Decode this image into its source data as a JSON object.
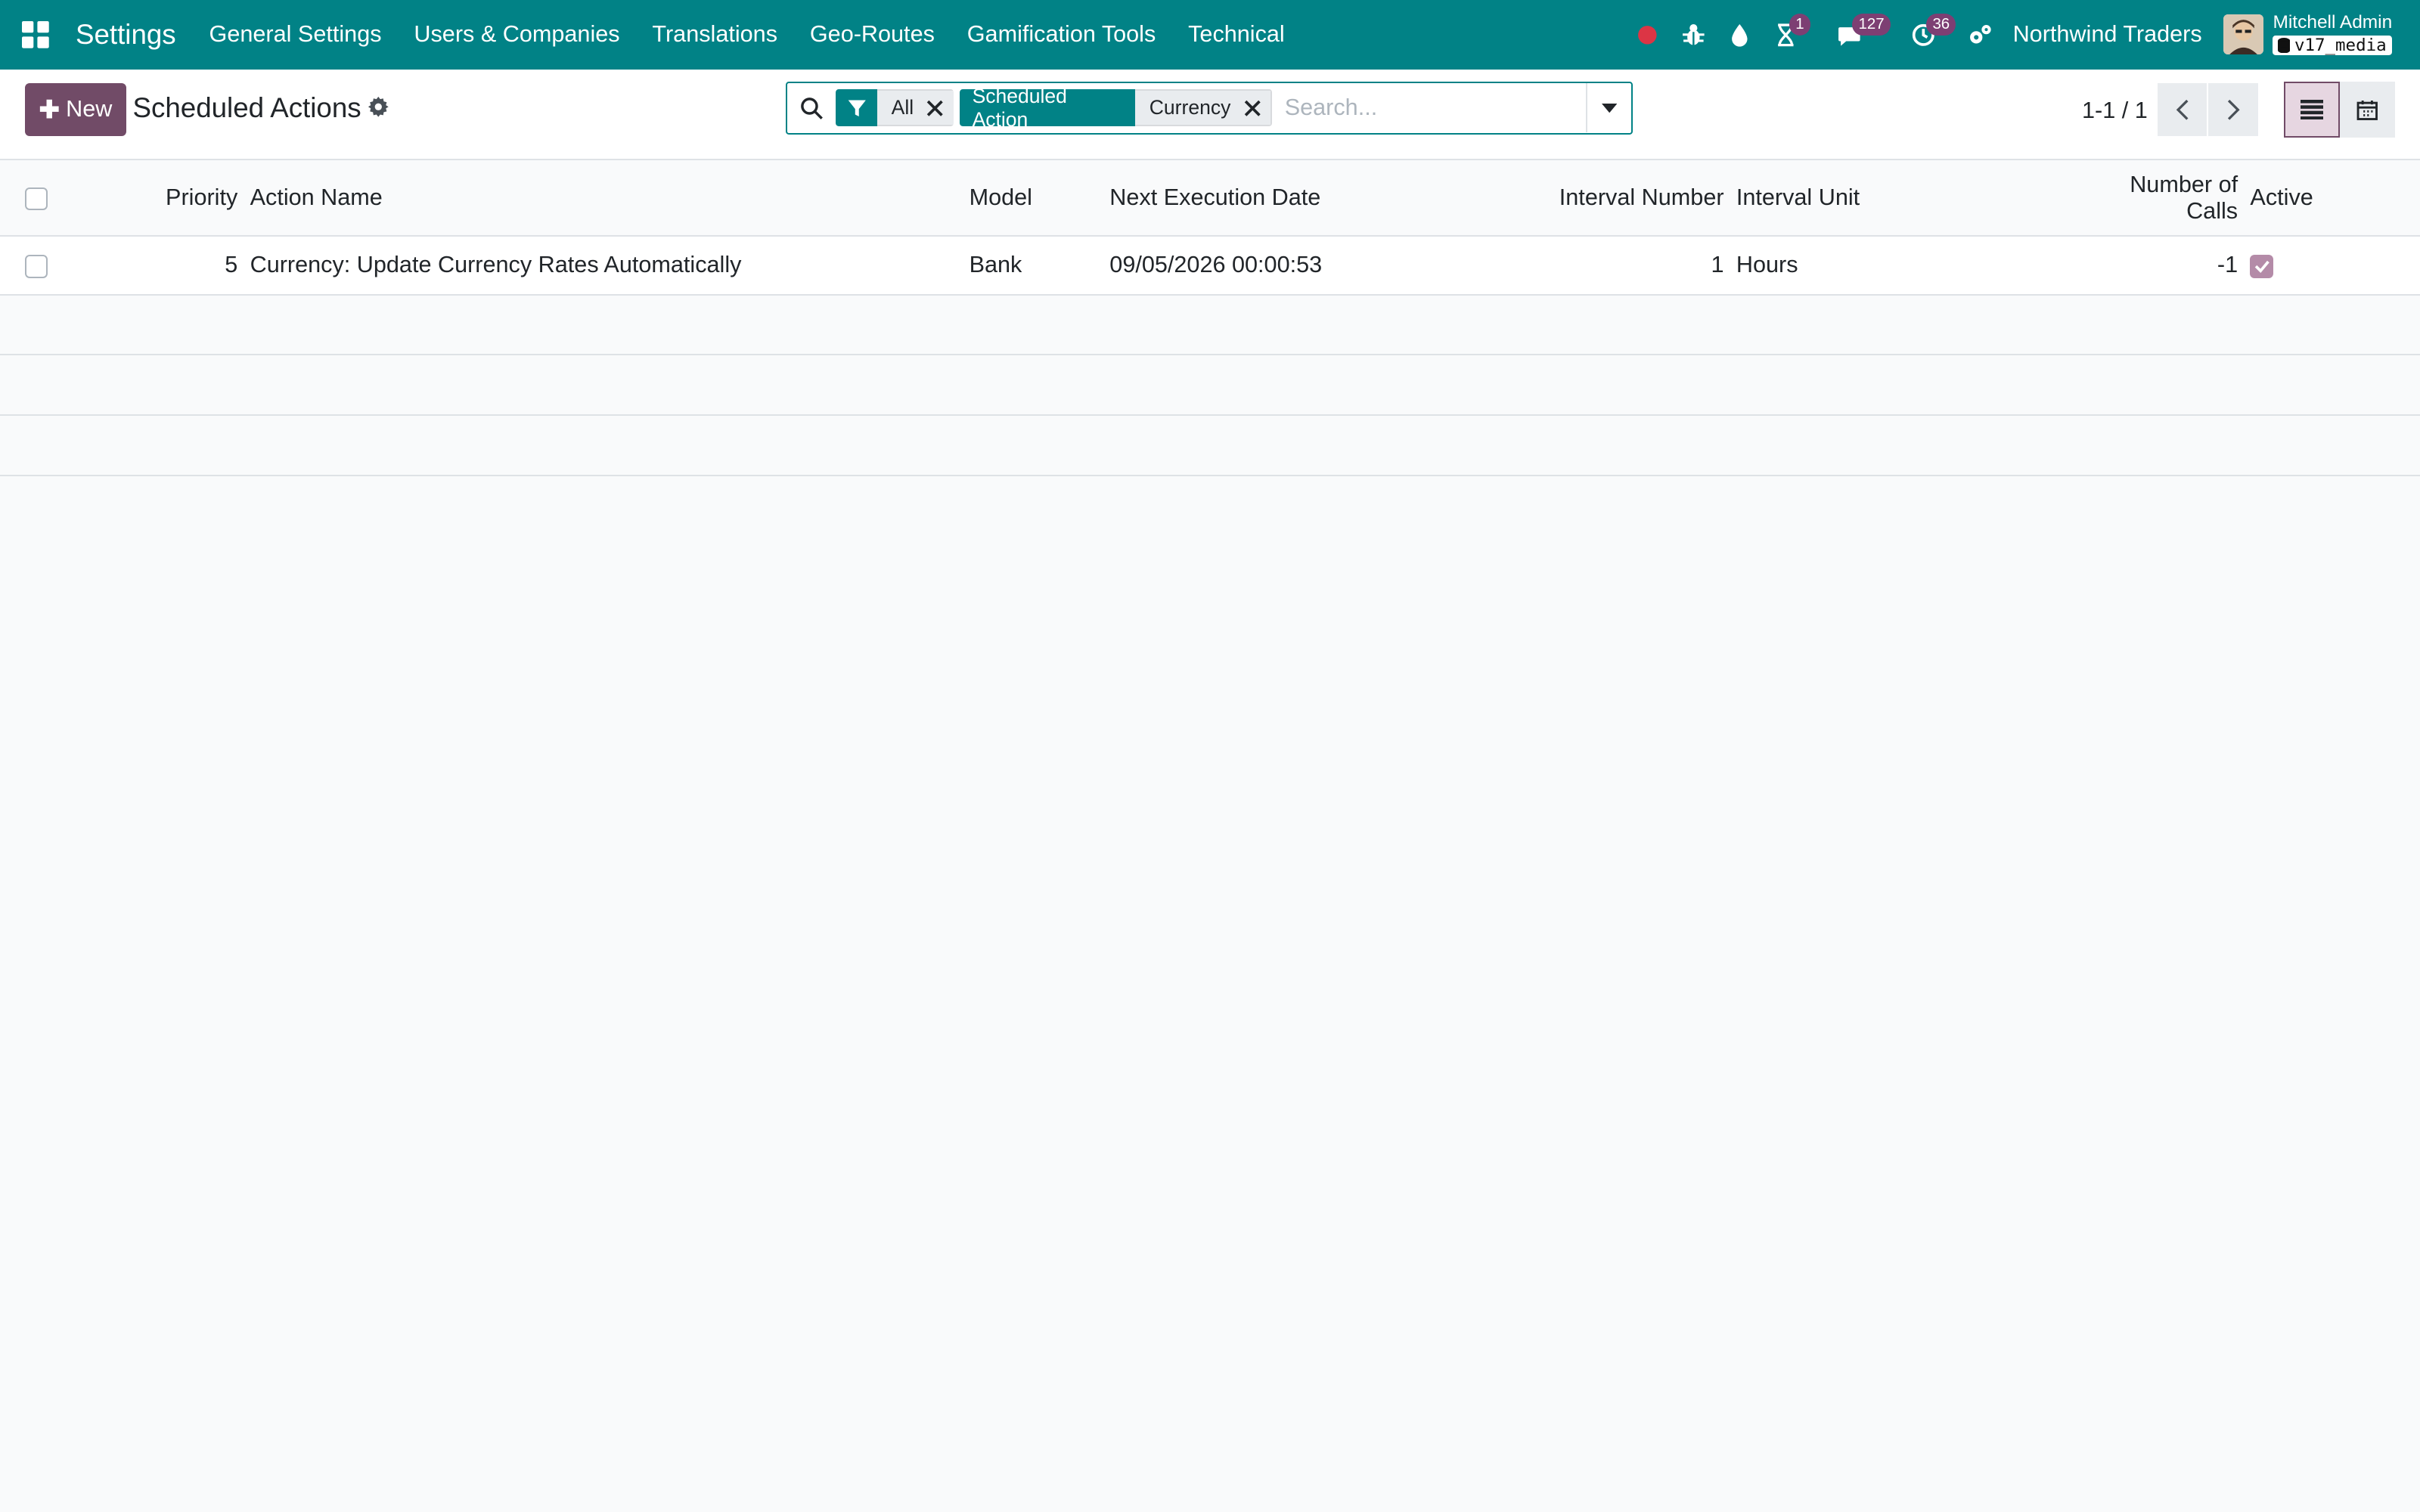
{
  "navbar": {
    "app_name": "Settings",
    "menu": [
      "General Settings",
      "Users & Companies",
      "Translations",
      "Geo-Routes",
      "Gamification Tools",
      "Technical"
    ],
    "activity_badge": "1",
    "messages_badge": "127",
    "clock_badge": "36",
    "company": "Northwind Traders",
    "user_name": "Mitchell Admin",
    "database": "v17_media",
    "colors": {
      "primary": "#018286",
      "accent": "#714b67",
      "record_dot": "#dc3545"
    }
  },
  "control_panel": {
    "new_label": "New",
    "title": "Scheduled Actions",
    "facets": [
      {
        "icon": "filter-icon",
        "values": "All"
      },
      {
        "label": "Scheduled Action",
        "values": "Currency"
      }
    ],
    "search_placeholder": "Search...",
    "pager": "1-1 / 1"
  },
  "table": {
    "columns": {
      "priority": "Priority",
      "action_name": "Action Name",
      "model": "Model",
      "next_execution": "Next Execution Date",
      "interval_number": "Interval Number",
      "interval_unit": "Interval Unit",
      "number_of_calls": "Number of Calls",
      "active": "Active"
    },
    "rows": [
      {
        "priority": "5",
        "action_name": "Currency: Update Currency Rates Automatically",
        "model": "Bank",
        "next_execution": "09/05/2026 00:00:53",
        "interval_number": "1",
        "interval_unit": "Hours",
        "number_of_calls": "-1",
        "active": true
      }
    ]
  }
}
